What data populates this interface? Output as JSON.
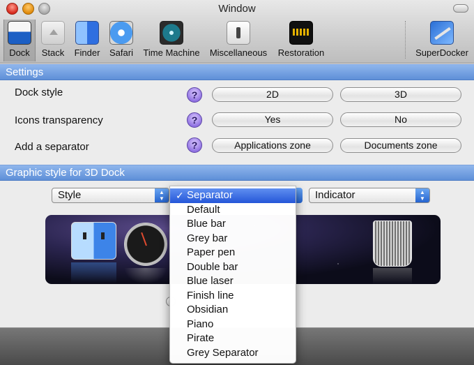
{
  "window": {
    "title": "Window"
  },
  "toolbar": {
    "items": [
      {
        "label": "Dock",
        "icon": "dock-icon",
        "selected": true
      },
      {
        "label": "Stack",
        "icon": "stack-icon"
      },
      {
        "label": "Finder",
        "icon": "finder-icon"
      },
      {
        "label": "Safari",
        "icon": "safari-icon"
      },
      {
        "label": "Time Machine",
        "icon": "time-machine-icon"
      },
      {
        "label": "Miscellaneous",
        "icon": "switch-icon"
      },
      {
        "label": "Restoration",
        "icon": "warning-display-icon"
      },
      {
        "label": "SuperDocker",
        "icon": "superdocker-icon"
      }
    ]
  },
  "settings": {
    "header": "Settings",
    "rows": [
      {
        "label": "Dock style",
        "help": "?",
        "options": [
          "2D",
          "3D"
        ]
      },
      {
        "label": "Icons transparency",
        "help": "?",
        "options": [
          "Yes",
          "No"
        ]
      },
      {
        "label": "Add a separator",
        "help": "?",
        "options": [
          "Applications zone",
          "Documents zone"
        ]
      }
    ]
  },
  "graphic": {
    "header": "Graphic style for 3D Dock",
    "style_popup": "Style",
    "indicator_popup": "Indicator",
    "separator_menu": {
      "checkmark": "✓",
      "selected": "Separator",
      "items": [
        "Separator",
        "Default",
        "Blue bar",
        "Grey bar",
        "Paper pen",
        "Double bar",
        "Blue laser",
        "Finish line",
        "Obsidian",
        "Piano",
        "Pirate",
        "Grey Separator"
      ]
    }
  },
  "colors": {
    "section_header": "#6f9be0",
    "menu_highlight": "#3a6fe0",
    "popup_arrow": "#2f6fd8"
  }
}
